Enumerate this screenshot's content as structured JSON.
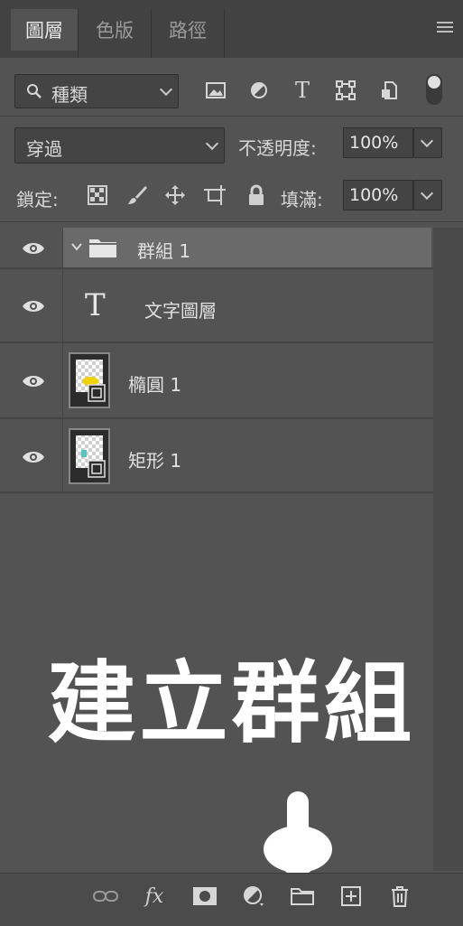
{
  "tabs": [
    {
      "label": "圖層",
      "active": true
    },
    {
      "label": "色版",
      "active": false
    },
    {
      "label": "路徑",
      "active": false
    }
  ],
  "filter": {
    "kind_label": "種類",
    "icons": [
      "image-filter-icon",
      "adjustment-filter-icon",
      "type-filter-icon",
      "shape-filter-icon",
      "smart-object-filter-icon"
    ],
    "type_glyph": "T"
  },
  "blend": {
    "mode": "穿過",
    "opacity_label": "不透明度:",
    "opacity_value": "100%"
  },
  "lock": {
    "label": "鎖定:",
    "fill_label": "填滿:",
    "fill_value": "100%"
  },
  "layers": [
    {
      "name": "群組 1",
      "type": "group",
      "selected": true
    },
    {
      "name": "文字圖層",
      "type": "text",
      "glyph": "T"
    },
    {
      "name": "橢圓 1",
      "type": "shape",
      "accent": "#f2d100"
    },
    {
      "name": "矩形 1",
      "type": "shape",
      "accent": "#4fc7c0"
    }
  ],
  "annotation": {
    "text": "建立群組"
  },
  "footer": {
    "fx_label": "fx"
  },
  "colors": {
    "panel": "#535353",
    "selected_row": "#6a6a6a",
    "accent_yellow": "#f2d100",
    "accent_teal": "#4fc7c0"
  }
}
